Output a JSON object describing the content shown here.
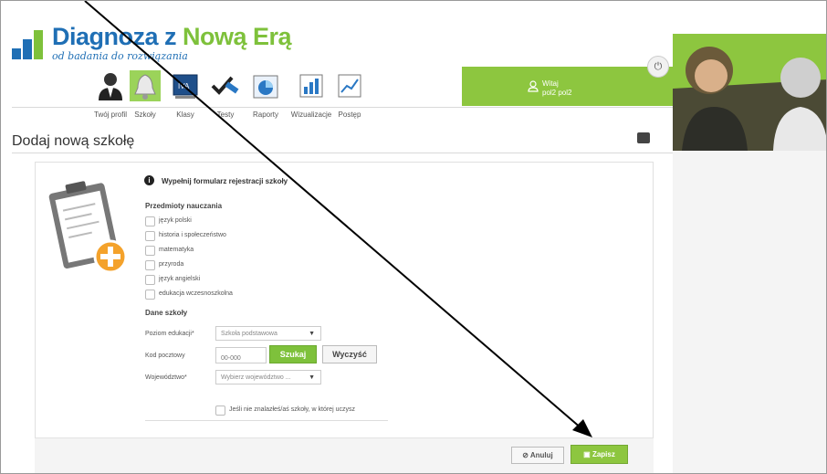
{
  "brand": {
    "title_part1": "Diagnoza z ",
    "title_part2": "Nową Erą",
    "subtitle": "od badania do rozwiązania"
  },
  "nav": {
    "items": [
      {
        "label": "Twój profil",
        "icon": "user-icon"
      },
      {
        "label": "Szkoły",
        "icon": "bell-icon"
      },
      {
        "label": "Klasy",
        "icon": "class-board-icon"
      },
      {
        "label": "Testy",
        "icon": "check-pen-icon"
      },
      {
        "label": "Raporty",
        "icon": "pie-chart-icon"
      },
      {
        "label": "Wizualizacje",
        "icon": "bar-chart-icon"
      },
      {
        "label": "Postęp",
        "icon": "line-chart-icon"
      }
    ]
  },
  "welcome": {
    "greeting": "Witaj",
    "username": "pol2 pol2"
  },
  "page": {
    "title": "Dodaj nową szkołę"
  },
  "form": {
    "info": "Wypełnij formularz rejestracji szkoły",
    "subjects_heading": "Przedmioty nauczania",
    "subjects": [
      "język polski",
      "historia i społeczeństwo",
      "matematyka",
      "przyroda",
      "język angielski",
      "edukacja wczesnoszkolna"
    ],
    "school_heading": "Dane szkoły",
    "education_level_label": "Poziom edukacji*",
    "education_level_value": "Szkoła podstawowa",
    "postal_code_label": "Kod pocztowy",
    "postal_code_placeholder": "00-000",
    "search_button": "Szukaj",
    "clear_button": "Wyczyść",
    "voivodeship_label": "Województwo*",
    "voivodeship_placeholder": "Wybierz województwo ...",
    "not_found_label": "Jeśli nie znalazłeś/aś szkoły, w której uczysz"
  },
  "footer": {
    "cancel_label": "Anuluj",
    "save_label": "Zapisz"
  },
  "colors": {
    "accent_green": "#8dc63f",
    "brand_blue": "#1f6fb5"
  }
}
